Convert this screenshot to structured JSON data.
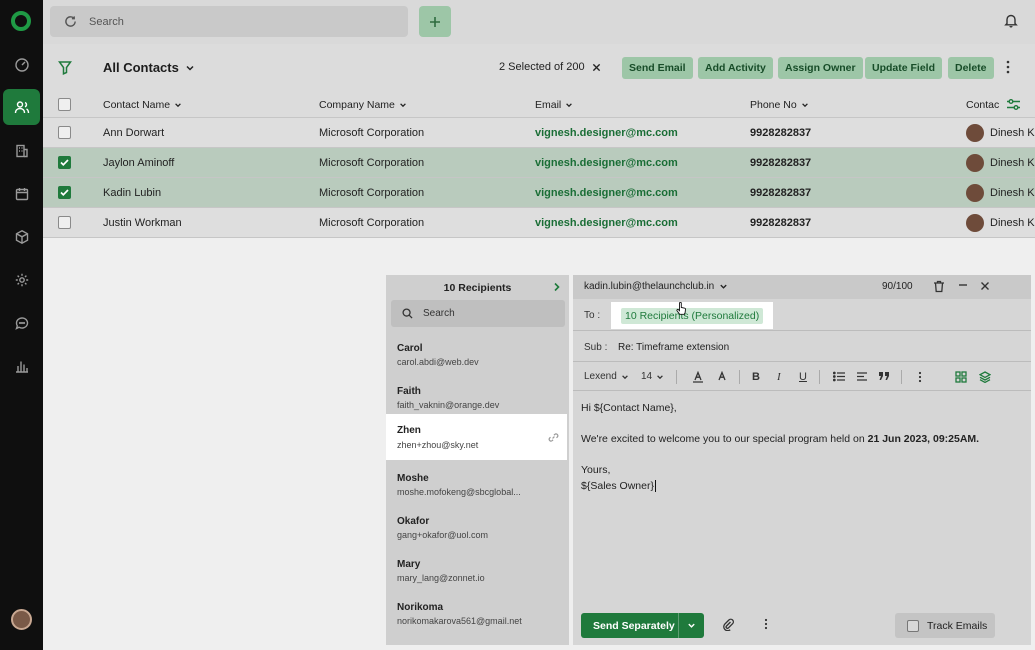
{
  "topbar": {
    "search_placeholder": "Search"
  },
  "toolbar": {
    "view_title": "All Contacts",
    "selection_text": "2 Selected of 200",
    "actions": [
      "Send Email",
      "Add Activity",
      "Assign Owner",
      "Update Field",
      "Delete"
    ]
  },
  "table": {
    "columns": [
      "Contact Name",
      "Company Name",
      "Email",
      "Phone No",
      "Contac"
    ],
    "rows": [
      {
        "name": "Ann Dorwart",
        "company": "Microsoft Corporation",
        "email": "vignesh.designer@mc.com",
        "phone": "9928282837",
        "owner": "Dinesh Ku",
        "selected": false
      },
      {
        "name": "Jaylon Aminoff",
        "company": "Microsoft Corporation",
        "email": "vignesh.designer@mc.com",
        "phone": "9928282837",
        "owner": "Dinesh Ku",
        "selected": true
      },
      {
        "name": "Kadin Lubin",
        "company": "Microsoft Corporation",
        "email": "vignesh.designer@mc.com",
        "phone": "9928282837",
        "owner": "Dinesh Ku",
        "selected": true
      },
      {
        "name": "Justin Workman",
        "company": "Microsoft Corporation",
        "email": "vignesh.designer@mc.com",
        "phone": "9928282837",
        "owner": "Dinesh Ku",
        "selected": false
      }
    ]
  },
  "recipients": {
    "title": "10 Recipients",
    "search_placeholder": "Search",
    "items": [
      {
        "name": "Carol",
        "email": "carol.abdi@web.dev"
      },
      {
        "name": "Faith",
        "email": "faith_vaknin@orange.dev"
      },
      {
        "name": "Zhen",
        "email": "zhen+zhou@sky.net"
      },
      {
        "name": "Moshe",
        "email": "moshe.mofokeng@sbcglobal..."
      },
      {
        "name": "Okafor",
        "email": "gang+okafor@uol.com"
      },
      {
        "name": "Mary",
        "email": "mary_lang@zonnet.io"
      },
      {
        "name": "Norikoma",
        "email": "norikomakarova561@gmail.net"
      }
    ]
  },
  "compose": {
    "from": "kadin.lubin@thelaunchclub.in",
    "count": "90/100",
    "to_label": "To :",
    "to_chip": "10 Recipients (Personalized)",
    "subject_label": "Sub :",
    "subject": "Re: Timeframe extension",
    "font": "Lexend",
    "font_size": "14",
    "body": {
      "greeting": "Hi ${Contact Name},",
      "line1": "We're excited to welcome you to our special program held on ",
      "line1_bold": "21 Jun 2023, 09:25AM.",
      "closing": "Yours,",
      "signature": "${Sales Owner}"
    },
    "send_label": "Send Separately",
    "track_label": "Track Emails"
  },
  "colors": {
    "brand": "#1f7a3c",
    "selected_row": "#b9cbbd",
    "sidebar": "#0f0f0f"
  }
}
